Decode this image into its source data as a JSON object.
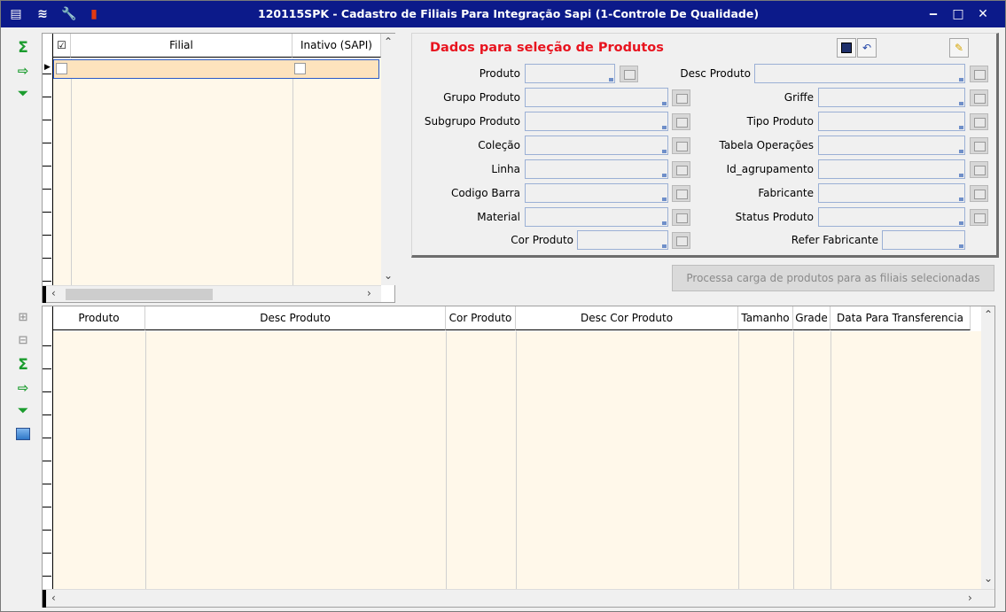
{
  "window": {
    "title": "120115SPK - Cadastro de Filiais Para Integração Sapi (1-Controle De Qualidade)",
    "minimize_label": "‒",
    "maximize_label": "□",
    "close_label": "✕"
  },
  "sidebar_top": [
    "sum-icon",
    "export-icon",
    "filter-icon"
  ],
  "sidebar_bottom": [
    "add-row-icon",
    "remove-row-icon",
    "sum-icon",
    "export-icon",
    "filter-icon",
    "image-icon"
  ],
  "filial_grid": {
    "columns": [
      "",
      "Filial",
      "Inativo (SAPI)"
    ],
    "check_header": "☑"
  },
  "panel": {
    "title": "Dados para seleção de Produtos",
    "save_icon": "save-icon",
    "undo_icon": "undo-icon",
    "clear_icon": "eraser-icon",
    "fields_left": [
      {
        "label": "Produto",
        "value": ""
      },
      {
        "label": "Grupo Produto",
        "value": ""
      },
      {
        "label": "Subgrupo Produto",
        "value": ""
      },
      {
        "label": "Coleção",
        "value": ""
      },
      {
        "label": "Linha",
        "value": ""
      },
      {
        "label": "Codigo Barra",
        "value": ""
      },
      {
        "label": "Material",
        "value": ""
      },
      {
        "label": "Cor Produto",
        "value": ""
      }
    ],
    "fields_right": [
      {
        "label": "Desc Produto",
        "value": ""
      },
      {
        "label": "Griffe",
        "value": ""
      },
      {
        "label": "Tipo Produto",
        "value": ""
      },
      {
        "label": "Tabela Operações",
        "value": ""
      },
      {
        "label": "Id_agrupamento",
        "value": ""
      },
      {
        "label": "Fabricante",
        "value": ""
      },
      {
        "label": "Status Produto",
        "value": ""
      },
      {
        "label": "Refer Fabricante",
        "value": ""
      }
    ]
  },
  "process_button": "Processa carga de produtos para as filiais selecionadas",
  "product_grid": {
    "columns": [
      "Produto",
      "Desc Produto",
      "Cor Produto",
      "Desc Cor Produto",
      "Tamanho",
      "Grade",
      "Data Para Transferencia"
    ]
  },
  "colors": {
    "titlebar": "#0c1a8a",
    "panel_title": "#e8141f",
    "grid_body": "#fff8ea",
    "selected_row": "#fde3bd"
  }
}
